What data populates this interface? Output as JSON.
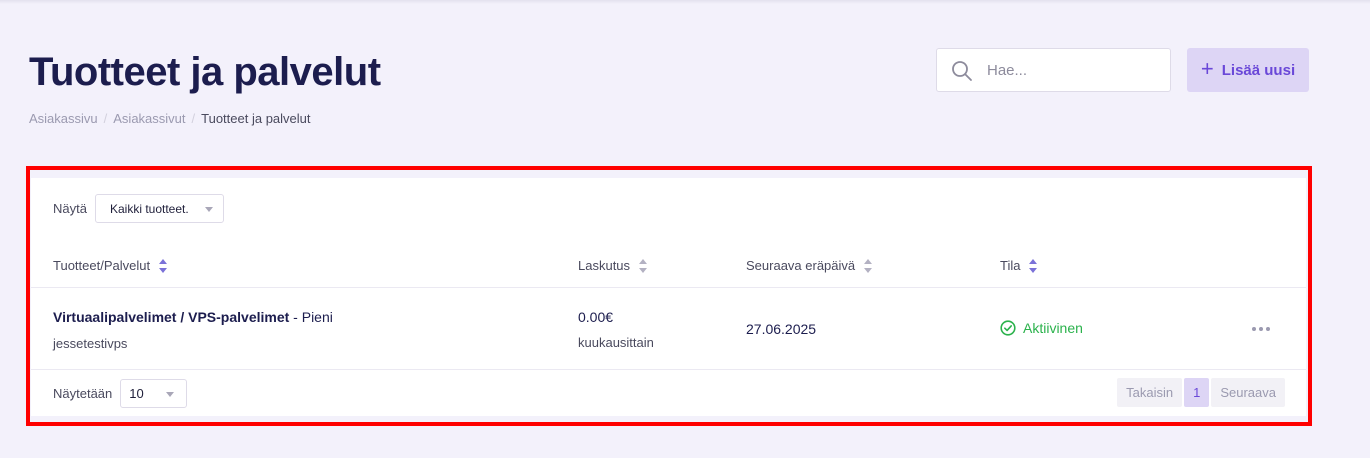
{
  "header": {
    "title": "Tuotteet ja palvelut",
    "breadcrumb": [
      "Asiakassivu",
      "Asiakassivut",
      "Tuotteet ja palvelut"
    ],
    "search_placeholder": "Hae...",
    "add_button_label": "Lisää uusi"
  },
  "filter": {
    "label": "Näytä",
    "selected": "Kaikki tuotteet."
  },
  "table": {
    "columns": [
      "Tuotteet/Palvelut",
      "Laskutus",
      "Seuraava eräpäivä",
      "Tila"
    ],
    "rows": [
      {
        "product": "Virtuaalipalvelimet / VPS-palvelimet",
        "variant": " - Pieni",
        "domain": "jessetestivps",
        "amount": "0.00€",
        "cycle": "kuukausittain",
        "due_date": "27.06.2025",
        "status": "Aktiivinen"
      }
    ]
  },
  "footer": {
    "per_page_label": "Näytetään",
    "per_page_value": "10",
    "prev_label": "Takaisin",
    "current_page": "1",
    "next_label": "Seuraava"
  },
  "colors": {
    "accent": "#6a48d8",
    "title": "#1c1d4e",
    "status_active": "#2bb24c",
    "highlight": "#ff0000"
  }
}
